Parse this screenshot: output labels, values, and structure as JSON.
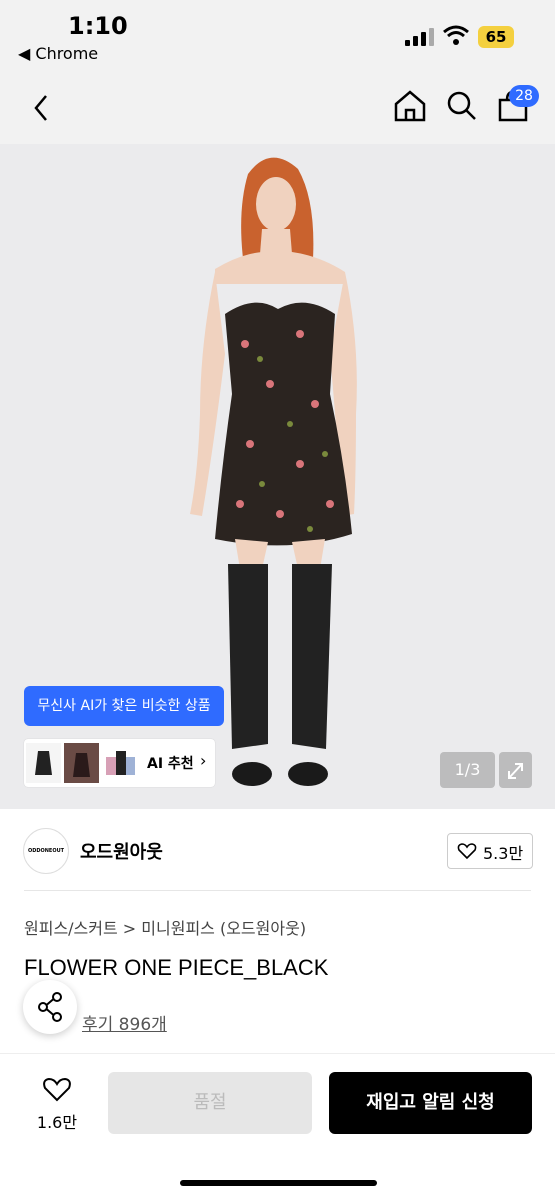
{
  "status": {
    "time": "1:10",
    "back_app": "◀ Chrome",
    "battery": "65"
  },
  "header": {
    "cart_count": "28"
  },
  "product_image": {
    "ai_bubble": "무신사 AI가 찾은 비슷한 상품",
    "ai_recommend": "AI 추천",
    "pager": "1/3"
  },
  "brand": {
    "logo_text": "ODDONEOUT",
    "name": "오드원아웃",
    "likes": "5.3만"
  },
  "product": {
    "breadcrumb": "원피스/스커트 > 미니원피스 (오드원아웃)",
    "title": "FLOWER ONE PIECE_BLACK",
    "reviews": "후기 896개"
  },
  "bottom": {
    "like_count": "1.6만",
    "soldout": "품절",
    "restock": "재입고 알림 신청"
  }
}
